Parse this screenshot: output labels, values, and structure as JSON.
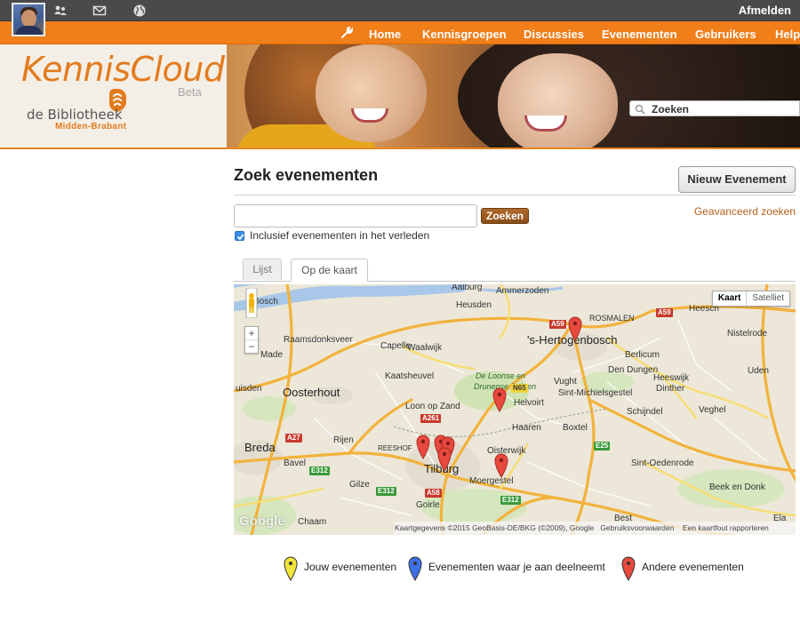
{
  "topbar": {
    "icons": [
      "user-avatar",
      "users-icon",
      "mail-icon",
      "globe-icon"
    ],
    "logout_label": "Afmelden"
  },
  "nav": {
    "items": [
      "Home",
      "Kennisgroepen",
      "Discussies",
      "Evenementen",
      "Gebruikers",
      "Help"
    ],
    "settings_icon": "wrench-icon"
  },
  "banner": {
    "logo": "KennisCloud",
    "logo_badge": "Beta",
    "library_name": "de Bibliotheek",
    "library_region": "Midden-Brabant",
    "search_placeholder": "Zoeken"
  },
  "page": {
    "title": "Zoek evenementen",
    "new_event_button": "Nieuw Evenement",
    "search_value": "",
    "search_button": "Zoeken",
    "advanced_search_link": "Geavanceerd zoeken",
    "include_past_label": "Inclusief evenementen in het verleden",
    "include_past_checked": true,
    "tabs": [
      {
        "label": "Lijst",
        "active": false
      },
      {
        "label": "Op de kaart",
        "active": true
      }
    ]
  },
  "map": {
    "type_options": [
      {
        "label": "Kaart",
        "selected": true
      },
      {
        "label": "Satelliet",
        "selected": false
      }
    ],
    "zoom_in": "+",
    "zoom_out": "−",
    "places": {
      "aalburg": "Aalburg",
      "ammerzoden": "Ammerzoden",
      "heusden": "Heusden",
      "rosmalen": "ROSMALEN",
      "heesch": "Heesch",
      "bosch_partial": "Bosch",
      "raamsdonksveer": "Raamsdonksveer",
      "capelle": "Capelle",
      "waalwijk": "Waalwijk",
      "hertogenbosch": "'s-Hertogenbosch",
      "berlicum": "Berlicum",
      "nistelrode": "Nistelrode",
      "made": "Made",
      "den_dungen": "Den Dungen",
      "kaatsheuvel": "Kaatsheuvel",
      "duinen_park_1": "De Loonse en",
      "duinen_park_2": "Drunense Duinen",
      "vught": "Vught",
      "heeswijk": "Heeswijk",
      "dinther": "Dinther",
      "uden": "Uden",
      "oosterhout": "Oosterhout",
      "teteringen_partial": "uisden",
      "sint_michielsgestel": "Sint-Michielsgestel",
      "helvoirt": "Helvoirt",
      "loon_op_zand": "Loon op Zand",
      "schijndel": "Schijndel",
      "veghel": "Veghel",
      "haaren": "Haaren",
      "boxtel": "Boxtel",
      "breda": "Breda",
      "rijen": "Rijen",
      "reeshof": "REESHOF",
      "oisterwijk": "Oisterwijk",
      "bavel": "Bavel",
      "tilburg": "Tilburg",
      "moergestel": "Moergestel",
      "sint_oedenrode": "Sint-Oedenrode",
      "gilze": "Gilze",
      "beek_en_donk": "Beek en Donk",
      "goirle": "Goirle",
      "chaam": "Chaam",
      "best": "Best",
      "ela_partial": "Ela",
      "road_a59_1": "A59",
      "road_a59_2": "A59",
      "road_a261": "A261",
      "road_n65": "N65",
      "road_a27": "A27",
      "road_e312_1": "E312",
      "road_e312_2": "E312",
      "road_e312_3": "E312",
      "road_e25": "E25",
      "road_a58": "A58"
    },
    "attribution": "Kaartgegevens ©2015 GeoBasis-DE/BKG (©2009), Google",
    "terms": "Gebruiksvoorwaarden",
    "report": "Een kaartfout rapporteren",
    "brand": "Google",
    "markers": [
      {
        "color": "#e8493f",
        "place": "'s-Hertogenbosch"
      },
      {
        "color": "#e8493f",
        "place": "Helvoirt"
      },
      {
        "color": "#e8493f",
        "place": "Tilburg"
      },
      {
        "color": "#e8493f",
        "place": "Tilburg"
      },
      {
        "color": "#e8493f",
        "place": "Tilburg"
      },
      {
        "color": "#e8493f",
        "place": "Tilburg"
      },
      {
        "color": "#e8493f",
        "place": "Oisterwijk"
      }
    ]
  },
  "legend": [
    {
      "color": "#f2e53a",
      "label": "Jouw evenementen"
    },
    {
      "color": "#3d6fe8",
      "label": "Evenementen waar je aan deelneemt"
    },
    {
      "color": "#e8493f",
      "label": "Andere evenementen"
    }
  ],
  "colors": {
    "brand_orange": "#f07f1a",
    "topbar_dark": "#4a4a4a",
    "link_orange": "#b4601c"
  }
}
